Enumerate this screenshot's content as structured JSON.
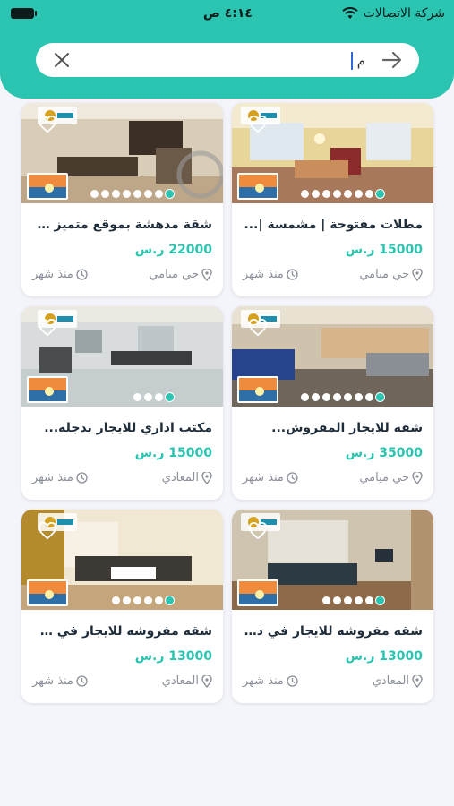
{
  "status_bar": {
    "carrier": "شركة الاتصالات",
    "time": "٤:١٤ ص"
  },
  "search": {
    "value": "م"
  },
  "colors": {
    "accent": "#2bc4b0",
    "title": "#1f2d3a",
    "muted": "#8a8f99"
  },
  "listings": [
    {
      "title": "مطلات مفتوحة | مشمسة |...",
      "price": "15000 ر.س",
      "location": "حي ميامي",
      "time": "منذ شهر",
      "dots": 8,
      "active_dot": 7
    },
    {
      "title": "شقة مدهشة بموقع متميز جد...",
      "price": "22000 ر.س",
      "location": "حي ميامي",
      "time": "منذ شهر",
      "dots": 8,
      "active_dot": 7
    },
    {
      "title": "شقه للايجار المفروش...",
      "price": "35000 ر.س",
      "location": "حي ميامي",
      "time": "منذ شهر",
      "dots": 8,
      "active_dot": 7
    },
    {
      "title": "مكتب اداري للايجار بدجله...",
      "price": "15000 ر.س",
      "location": "المعادي",
      "time": "منذ شهر",
      "dots": 4,
      "active_dot": 3
    },
    {
      "title": "شقه مفروشه للايجار في دجله...",
      "price": "13000 ر.س",
      "location": "المعادي",
      "time": "منذ شهر",
      "dots": 6,
      "active_dot": 5
    },
    {
      "title": "شقه مفروشه للايجار في زهرا...",
      "price": "13000 ر.س",
      "location": "المعادي",
      "time": "منذ شهر",
      "dots": 6,
      "active_dot": 5
    }
  ]
}
